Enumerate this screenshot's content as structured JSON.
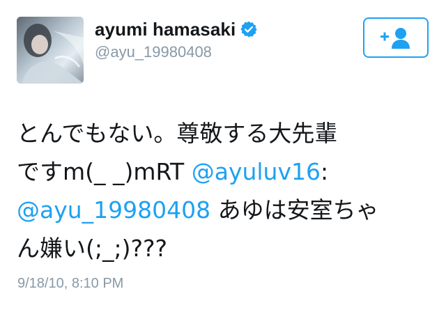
{
  "user": {
    "display_name": "ayumi hamasaki",
    "handle": "@ayu_19980408",
    "verified_icon": "verified-badge-icon"
  },
  "follow_button": {
    "icon": "add-person-icon"
  },
  "tweet": {
    "line1": "とんでもない。尊敬する大先輩",
    "line2_pre": "ですm(_ _)mRT ",
    "line2_mention": "@ayuluv16",
    "line2_post": ":",
    "line3_mention": "@ayu_19980408",
    "line3_post": " あゆは安室ちゃ",
    "line4": "ん嫌い(;_;)???"
  },
  "timestamp": "9/18/10, 8:10 PM",
  "colors": {
    "accent": "#1da1f2",
    "text": "#14171a",
    "muted": "#8899a6"
  }
}
